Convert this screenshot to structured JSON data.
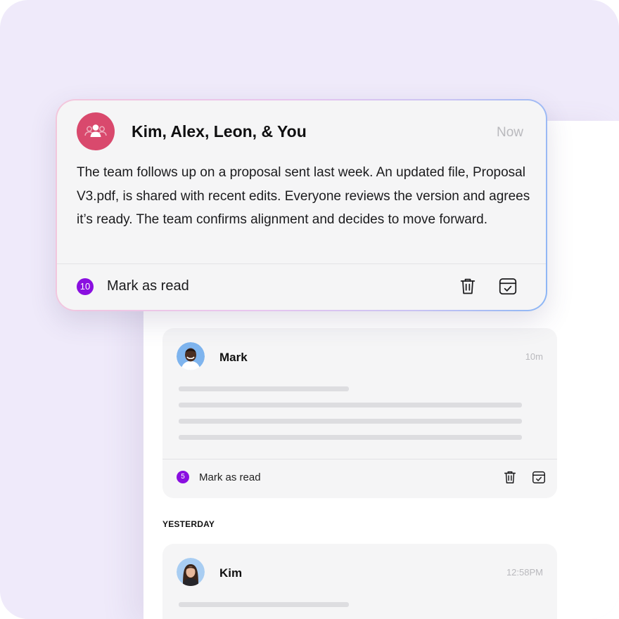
{
  "popup": {
    "title": "Kim, Alex, Leon, & You",
    "time": "Now",
    "body": "The team follows up on a proposal sent last week. An updated file, Proposal V3.pdf, is shared with recent edits. Everyone reviews the version and agrees it’s ready. The team confirms alignment and decides to move forward.",
    "unread_count": "10",
    "mark_read_label": "Mark as read",
    "avatar_icon": "group-icon",
    "avatar_color": "#d9496d"
  },
  "messages": [
    {
      "name": "Mark",
      "time": "10m",
      "unread_count": "5",
      "mark_read_label": "Mark as read"
    },
    {
      "name": "Kim",
      "time": "12:58PM"
    }
  ],
  "sections": {
    "yesterday": "YESTERDAY"
  },
  "colors": {
    "accent": "#8a0fe0",
    "background": "#efeafa"
  }
}
